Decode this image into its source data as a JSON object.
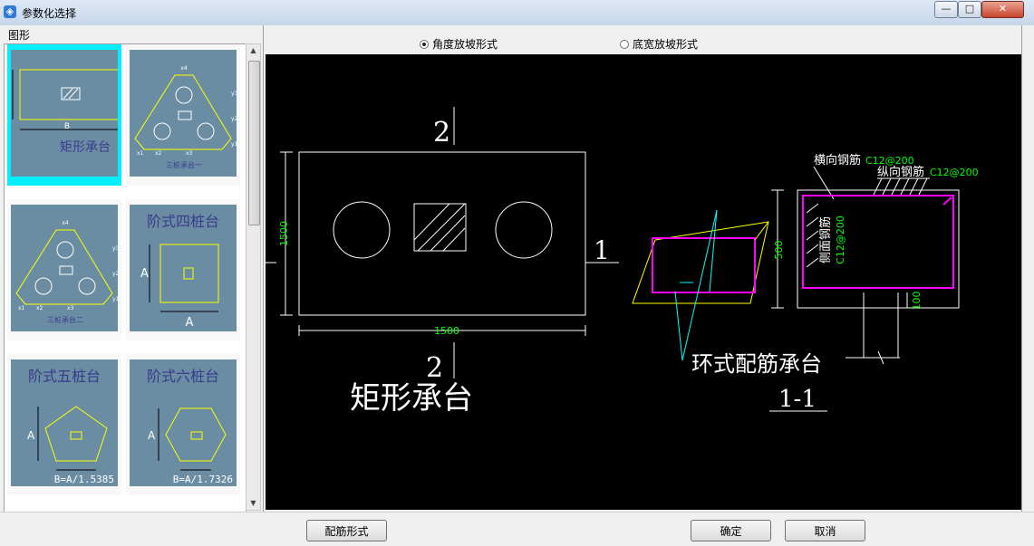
{
  "window": {
    "title": "参数化选择",
    "minimize": "—",
    "maximize": "□",
    "close": "✕"
  },
  "left_panel": {
    "group_label": "图形",
    "thumbnails": [
      {
        "title": "矩形承台",
        "dims": [
          "B"
        ],
        "selected": true
      },
      {
        "title": "三桩承台一",
        "dims": [
          "x1",
          "x2",
          "x3",
          "x4",
          "y1",
          "y2",
          "y3"
        ],
        "selected": false
      },
      {
        "title": "三桩承台二",
        "dims": [
          "x1",
          "x2",
          "x3",
          "x4",
          "y1",
          "y2",
          "y3"
        ],
        "selected": false
      },
      {
        "title": "阶式四桩台",
        "dims": [
          "A",
          "A"
        ],
        "selected": false
      },
      {
        "title": "阶式五桩台",
        "dims": [
          "A",
          "B=A/1.5385"
        ],
        "selected": false
      },
      {
        "title": "阶式六桩台",
        "dims": [
          "A",
          "B=A/1.7326"
        ],
        "selected": false
      }
    ]
  },
  "header": {
    "radios": [
      {
        "label": "角度放坡形式",
        "checked": true
      },
      {
        "label": "底宽放坡形式",
        "checked": false
      }
    ]
  },
  "drawing": {
    "section_mark": "2",
    "side_mark": "1",
    "dim_width": "1500",
    "dim_height": "1500",
    "plan_title": "矩形承台",
    "ring_title": "环式配筋承台",
    "section_title": "1-1",
    "label_transverse": "横向钢筋",
    "label_transverse_value": "C12@200",
    "label_longitudinal": "纵向钢筋",
    "label_longitudinal_value": "C12@200",
    "label_side": "侧面钢筋",
    "label_side_value": "C12@200",
    "dim_500": "500",
    "dim_100": "100"
  },
  "colors": {
    "canvas": "#000000",
    "line": "#ffffff",
    "magenta": "#ff00ff",
    "yellow": "#ffff00",
    "cyan": "#00ffff",
    "green": "#00ff00",
    "thumb_bg": "#6a8da3",
    "thumb_title": "#3a3a8c",
    "selected": "#00f0ff"
  },
  "footer": {
    "rebar_button": "配筋形式",
    "ok_button": "确定",
    "cancel_button": "取消"
  }
}
